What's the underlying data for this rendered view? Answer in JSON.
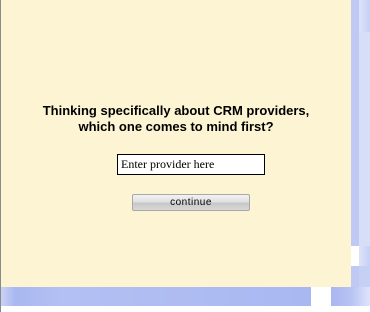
{
  "survey": {
    "question_line1": "Thinking specifically about CRM providers,",
    "question_line2": "which one comes to mind first?",
    "input_value": "Enter provider here",
    "continue_label": "continue"
  },
  "colors": {
    "panel_background": "#fcf4d2",
    "accent_blue": "#aab8f1"
  }
}
